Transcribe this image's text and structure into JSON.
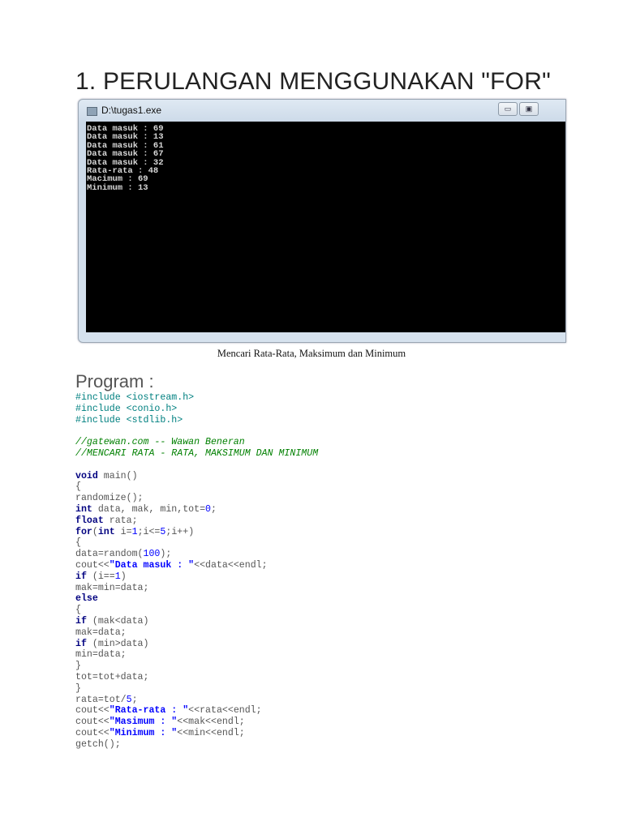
{
  "heading": "1. PERULANGAN MENGGUNAKAN \"FOR\"",
  "window": {
    "title": "D:\\tugas1.exe",
    "minimize_icon": "minimize-icon",
    "maximize_icon": "maximize-icon",
    "output_lines": [
      "Data masuk : 69",
      "Data masuk : 13",
      "Data masuk : 61",
      "Data masuk : 67",
      "Data masuk : 32",
      "Rata-rata : 48",
      "Macimum : 69",
      "Minimum : 13"
    ]
  },
  "caption": "Mencari Rata-Rata, Maksimum dan Minimum",
  "program_label": "Program :",
  "code_lines": [
    [
      [
        "pp",
        "#include <iostream.h>"
      ]
    ],
    [
      [
        "pp",
        "#include <conio.h>"
      ]
    ],
    [
      [
        "pp",
        "#include <stdlib.h>"
      ]
    ],
    [],
    [
      [
        "cm",
        "//gatewan.com -- Wawan Beneran"
      ]
    ],
    [
      [
        "cm",
        "//MENCARI RATA - RATA, MAKSIMUM DAN MINIMUM"
      ]
    ],
    [],
    [
      [
        "kw",
        "void"
      ],
      [
        "t",
        " main()"
      ]
    ],
    [
      [
        "t",
        "{"
      ]
    ],
    [
      [
        "t",
        "randomize();"
      ]
    ],
    [
      [
        "kw",
        "int"
      ],
      [
        "t",
        " data, mak, min,tot="
      ],
      [
        "num",
        "0"
      ],
      [
        "t",
        ";"
      ]
    ],
    [
      [
        "kw",
        "float"
      ],
      [
        "t",
        " rata;"
      ]
    ],
    [
      [
        "kw",
        "for"
      ],
      [
        "t",
        "("
      ],
      [
        "kw",
        "int"
      ],
      [
        "t",
        " i="
      ],
      [
        "num",
        "1"
      ],
      [
        "t",
        ";i<="
      ],
      [
        "num",
        "5"
      ],
      [
        "t",
        ";i++)"
      ]
    ],
    [
      [
        "t",
        "{"
      ]
    ],
    [
      [
        "t",
        "data=random("
      ],
      [
        "num",
        "100"
      ],
      [
        "t",
        ");"
      ]
    ],
    [
      [
        "t",
        "cout<<"
      ],
      [
        "str",
        "\"Data masuk : \""
      ],
      [
        "t",
        "<<data<<endl;"
      ]
    ],
    [
      [
        "kw",
        "if"
      ],
      [
        "t",
        " (i=="
      ],
      [
        "num",
        "1"
      ],
      [
        "t",
        ")"
      ]
    ],
    [
      [
        "t",
        "mak=min=data;"
      ]
    ],
    [
      [
        "kw",
        "else"
      ]
    ],
    [
      [
        "t",
        "{"
      ]
    ],
    [
      [
        "kw",
        "if"
      ],
      [
        "t",
        " (mak<data)"
      ]
    ],
    [
      [
        "t",
        "mak=data;"
      ]
    ],
    [
      [
        "kw",
        "if"
      ],
      [
        "t",
        " (min>data)"
      ]
    ],
    [
      [
        "t",
        "min=data;"
      ]
    ],
    [
      [
        "t",
        "}"
      ]
    ],
    [
      [
        "t",
        "tot=tot+data;"
      ]
    ],
    [
      [
        "t",
        "}"
      ]
    ],
    [
      [
        "t",
        "rata=tot/"
      ],
      [
        "num",
        "5"
      ],
      [
        "t",
        ";"
      ]
    ],
    [
      [
        "t",
        "cout<<"
      ],
      [
        "str",
        "\"Rata-rata : \""
      ],
      [
        "t",
        "<<rata<<endl;"
      ]
    ],
    [
      [
        "t",
        "cout<<"
      ],
      [
        "str",
        "\"Masimum : \""
      ],
      [
        "t",
        "<<mak<<endl;"
      ]
    ],
    [
      [
        "t",
        "cout<<"
      ],
      [
        "str",
        "\"Minimum : \""
      ],
      [
        "t",
        "<<min<<endl;"
      ]
    ],
    [
      [
        "t",
        "getch();"
      ]
    ]
  ]
}
